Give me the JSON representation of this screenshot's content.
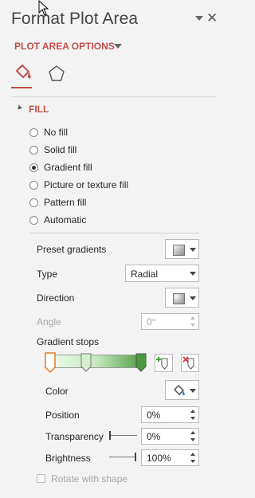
{
  "pane": {
    "title": "Format Plot Area",
    "section": "PLOT AREA OPTIONS",
    "fill_header": "FILL"
  },
  "fill_options": [
    {
      "label": "No fill",
      "checked": false
    },
    {
      "label": "Solid fill",
      "checked": false
    },
    {
      "label": "Gradient fill",
      "checked": true
    },
    {
      "label": "Picture or texture fill",
      "checked": false
    },
    {
      "label": "Pattern fill",
      "checked": false
    },
    {
      "label": "Automatic",
      "checked": false
    }
  ],
  "labels": {
    "preset_gradients": "Preset gradients",
    "type": "Type",
    "direction": "Direction",
    "angle": "Angle",
    "gradient_stops": "Gradient stops",
    "color": "Color",
    "position": "Position",
    "transparency": "Transparency",
    "brightness": "Brightness",
    "rotate_with_shape": "Rotate with shape"
  },
  "values": {
    "type": "Radial",
    "angle": "0°",
    "position": "0%",
    "transparency": "0%",
    "brightness": "100%"
  },
  "colors": {
    "accent": "#c0504d",
    "gradient_start": "#f0fbef",
    "gradient_end": "#4a9a3d"
  }
}
